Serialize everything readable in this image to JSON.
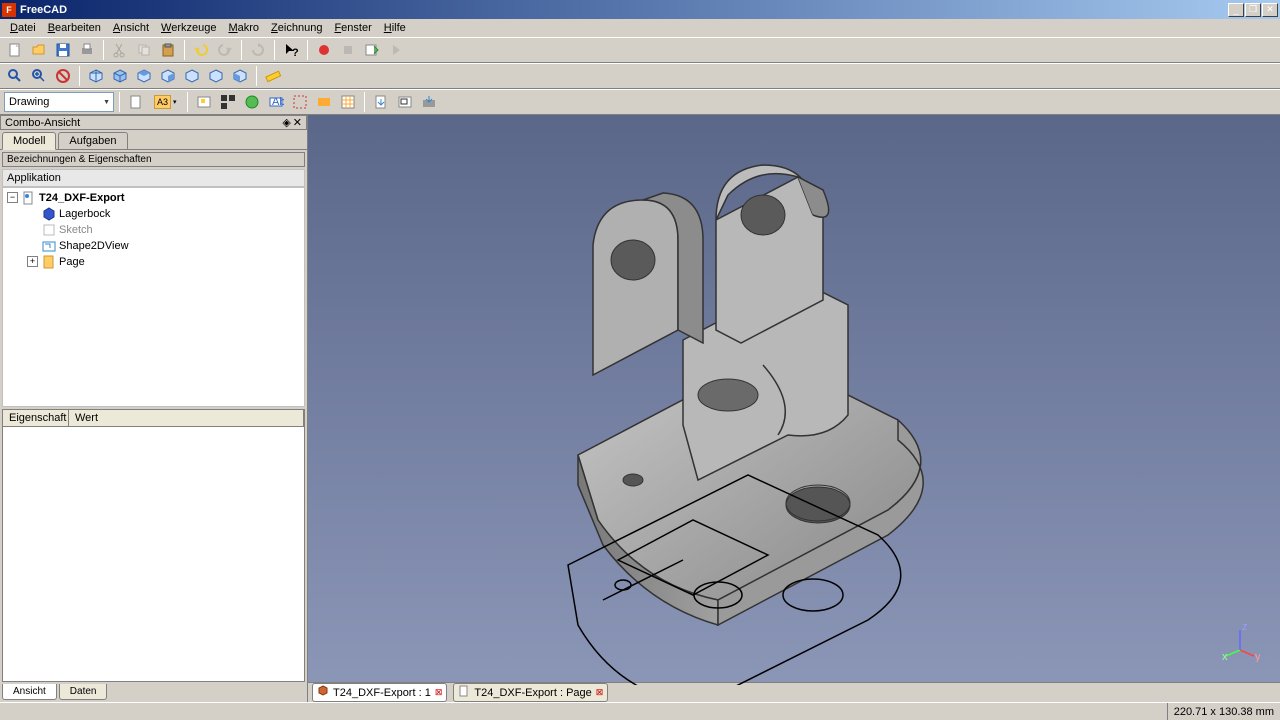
{
  "app": {
    "title": "FreeCAD"
  },
  "menubar": [
    {
      "u": "D",
      "rest": "atei"
    },
    {
      "u": "B",
      "rest": "earbeiten"
    },
    {
      "u": "A",
      "rest": "nsicht"
    },
    {
      "u": "W",
      "rest": "erkzeuge"
    },
    {
      "u": "M",
      "rest": "akro"
    },
    {
      "u": "Z",
      "rest": "eichnung"
    },
    {
      "u": "F",
      "rest": "enster"
    },
    {
      "u": "H",
      "rest": "ilfe"
    }
  ],
  "workbench": "Drawing",
  "a3label": "A3",
  "combo": {
    "title": "Combo-Ansicht",
    "tabs": {
      "model": "Modell",
      "tasks": "Aufgaben"
    },
    "groupHeader": "Bezeichnungen & Eigenschaften",
    "appLabel": "Applikation",
    "tree": {
      "doc": "T24_DXF-Export",
      "items": [
        "Lagerbock",
        "Sketch",
        "Shape2DView",
        "Page"
      ]
    },
    "propHeaders": {
      "name": "Eigenschaft",
      "value": "Wert"
    },
    "bottomTabs": {
      "view": "Ansicht",
      "data": "Daten"
    }
  },
  "docTabs": [
    {
      "icon": "doc3d",
      "label": "T24_DXF-Export : 1",
      "active": true
    },
    {
      "icon": "docpage",
      "label": "T24_DXF-Export : Page",
      "active": false
    }
  ],
  "status": {
    "coords": "220.71 x 130.38 mm"
  },
  "axes": {
    "x": "x",
    "y": "y",
    "z": "z"
  }
}
